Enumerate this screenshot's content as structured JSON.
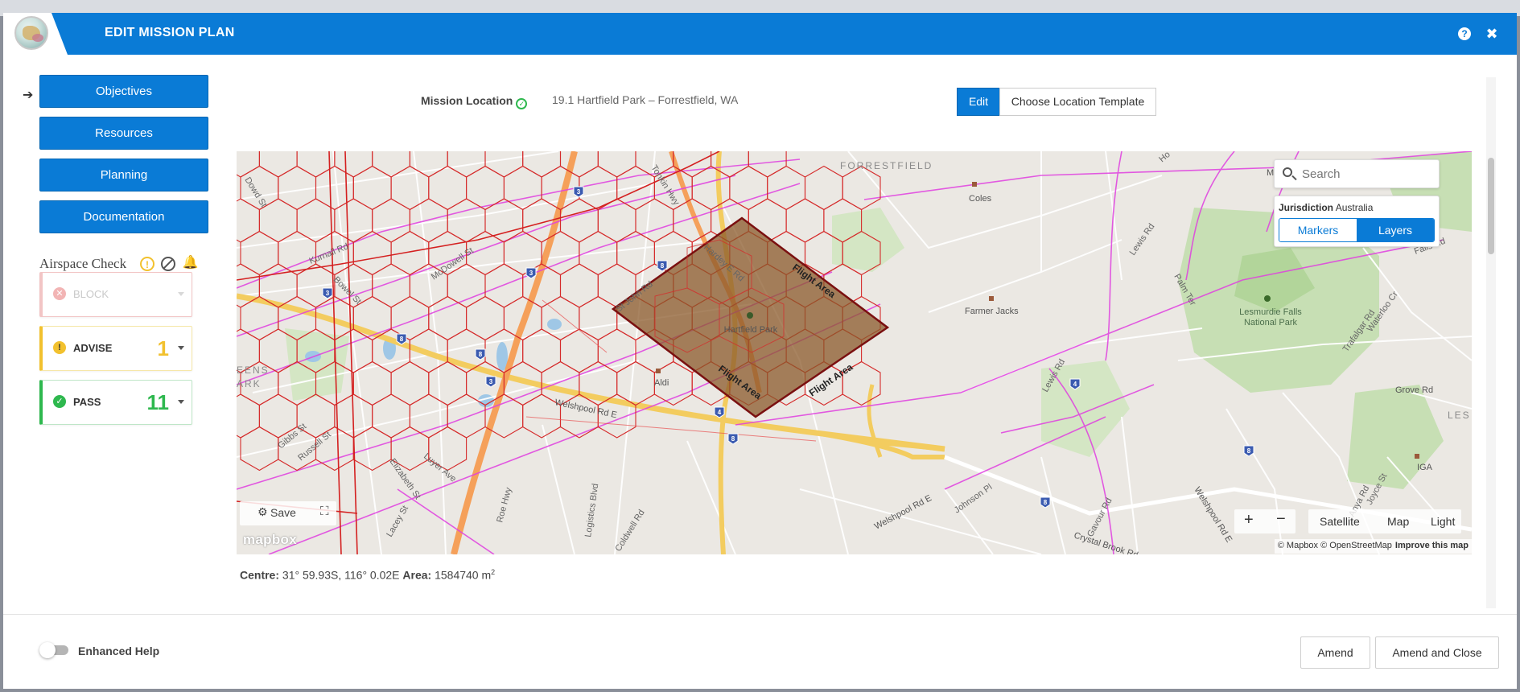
{
  "header": {
    "title": "EDIT MISSION PLAN",
    "help_glyph": "?",
    "close_glyph": "✖"
  },
  "sidebar": {
    "active_arrow": "➔",
    "nav": [
      {
        "label": "Objectives"
      },
      {
        "label": "Resources"
      },
      {
        "label": "Planning"
      },
      {
        "label": "Documentation"
      }
    ],
    "airspace_check": {
      "title": "Airspace Check",
      "cards": [
        {
          "label": "BLOCK",
          "count": "",
          "color": "#f2b4b4"
        },
        {
          "label": "ADVISE",
          "count": "1",
          "color": "#f2c12e"
        },
        {
          "label": "PASS",
          "count": "11",
          "color": "#2eb84e"
        }
      ]
    }
  },
  "location": {
    "label": "Mission Location",
    "value": "19.1 Hartfield Park – Forrestfield, WA",
    "edit_label": "Edit",
    "template_label": "Choose Location Template"
  },
  "map": {
    "search_placeholder": "Search",
    "jurisdiction_label": "Jurisdiction",
    "jurisdiction_value": "Australia",
    "toggle_markers": "Markers",
    "toggle_layers": "Layers",
    "save_label": "Save",
    "mapbox_logo": "mapbox",
    "zoom_in": "+",
    "zoom_out": "−",
    "style_options": [
      "Satellite",
      "Map",
      "Light"
    ],
    "attribution": "© Mapbox © OpenStreetMap",
    "improve_link": "Improve this map",
    "flight_area_label": "Flight Area",
    "place_labels": {
      "forrestfield": "FORRESTFIELD",
      "coles": "Coles",
      "farmer_jacks": "Farmer Jacks",
      "hartfield_park": "Hartfield Park",
      "aldi": "Aldi",
      "mundy": "Mundy F",
      "lesmurdie_1": "Lesmurdie Falls",
      "lesmurdie_2": "National Park",
      "iga": "IGA",
      "les": "LES",
      "eens": "EENS",
      "ark": "ARK",
      "lewis_rd_1": "Lewis Rd",
      "lewis_rd_2": "Lewis Rd",
      "palm_ter": "Palm Ter",
      "falls_rd": "Falls Rd",
      "trafalgar": "Trafalgar Rd",
      "waterloo": "Waterloo Cr",
      "grove_rd": "Grove Rd",
      "welshpool_1": "Welshpool Rd E",
      "welshpool_2": "Welshpool Rd E",
      "welshpool_3": "Welshpool Rd E",
      "johnson_pl": "Johnson Pl",
      "crystal_brook": "Crystal Brook Rd",
      "gavour_rd": "Gavour Rd",
      "joyce_st": "Joyce St",
      "anya_rd": "Anya Rd",
      "kurnall_rd": "Kurnall Rd",
      "dowd_st": "Dowd St",
      "mcdowell_st": "McDowell St",
      "bowel_st": "Bowel St",
      "st_john_rd": "St John Rd",
      "hardey_e_rd": "Hardey E Rd",
      "tonkin_hwy": "Tonkin Hwy",
      "gibbs_st": "Gibbs St",
      "russell_st": "Russell St",
      "elizabeth_st": "Elizabeth St",
      "luyer_ave": "Luyer Ave",
      "lacey_st": "Lacey St",
      "roe_hwy": "Roe Hwy",
      "logistics_blvd": "Logistics Blvd",
      "coldwell_rd": "Coldwell Rd",
      "hol": "Ho"
    },
    "route_shields": [
      "3",
      "3",
      "3",
      "8",
      "8",
      "3",
      "8",
      "4",
      "4",
      "8",
      "8",
      "8"
    ]
  },
  "map_info": {
    "centre_label": "Centre:",
    "centre_value": "31° 59.93S, 116° 0.02E",
    "area_label": "Area:",
    "area_value": "1584740 m",
    "area_unit_sup": "2"
  },
  "footer": {
    "toggle_label": "Enhanced Help",
    "amend_label": "Amend",
    "amend_close_label": "Amend and Close"
  },
  "colors": {
    "primary": "#0a7bd6",
    "hex_grid": "#d52b2b",
    "flight_area_fill": "#8b5a2b",
    "flight_area_stroke": "#7a1010",
    "advise": "#f2c12e",
    "pass": "#2eb84e"
  }
}
